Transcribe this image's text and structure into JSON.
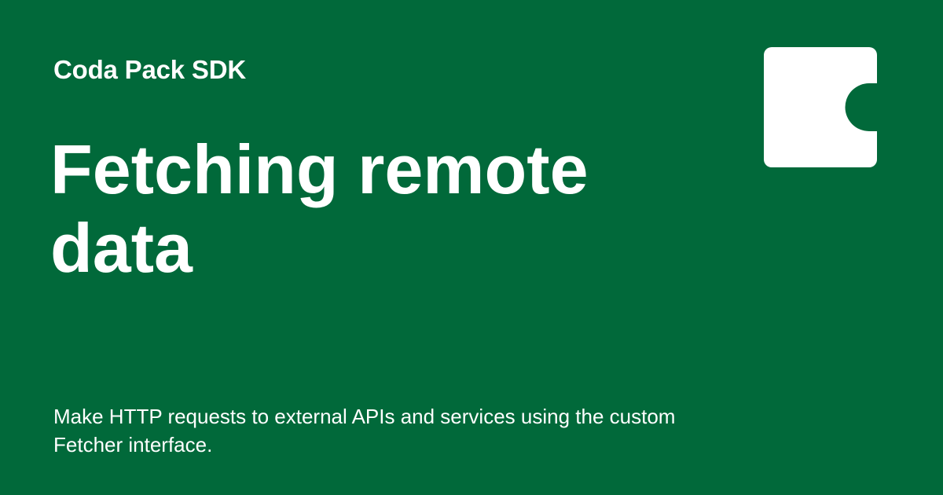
{
  "brand": {
    "eyebrow": "Coda Pack SDK",
    "logo_icon": "coda-logo-icon"
  },
  "page": {
    "title": "Fetching remote data",
    "description": "Make HTTP requests to external APIs and services using the custom Fetcher interface."
  },
  "colors": {
    "background": "#01693A",
    "text": "#FFFFFF",
    "logo": "#FFFFFF"
  }
}
